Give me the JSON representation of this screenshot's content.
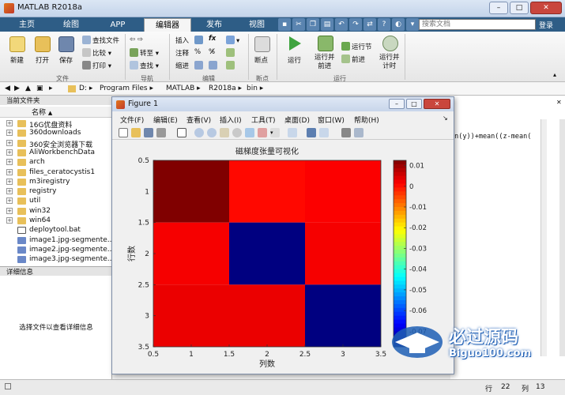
{
  "window": {
    "title": "MATLAB R2018a"
  },
  "tabs": [
    "主页",
    "绘图",
    "APP",
    "编辑器",
    "发布",
    "视图"
  ],
  "active_tab": "编辑器",
  "search": {
    "placeholder": "搜索文档"
  },
  "login": "登录",
  "ribbon": {
    "file": {
      "new": "新建",
      "open": "打开",
      "save": "保存",
      "find_files": "查找文件",
      "compare": "比较",
      "print": "打印",
      "group": "文件"
    },
    "nav": {
      "goto": "转至",
      "find": "查找",
      "group": "导航"
    },
    "edit": {
      "insert": "插入",
      "comment": "注释",
      "indent": "缩进",
      "fx": "fx",
      "group": "编辑"
    },
    "breakpoints": {
      "label": "断点",
      "group": "断点"
    },
    "run": {
      "run": "运行",
      "run_advance": "运行并\n前进",
      "run_section": "运行节",
      "advance": "前进",
      "run_time": "运行并\n计时",
      "group": "运行"
    }
  },
  "address": [
    "D:",
    "Program Files",
    "MATLAB",
    "R2018a",
    "bin"
  ],
  "left_panel": {
    "title": "当前文件夹",
    "col_name": "名称",
    "sort_arrow": "▲",
    "files": [
      {
        "name": "16G优盘资料",
        "type": "folder"
      },
      {
        "name": "360downloads",
        "type": "folder"
      },
      {
        "name": "360安全浏览器下载",
        "type": "folder"
      },
      {
        "name": "AliWorkbenchData",
        "type": "folder"
      },
      {
        "name": "arch",
        "type": "folder"
      },
      {
        "name": "files_ceratocystis1",
        "type": "folder"
      },
      {
        "name": "m3iregistry",
        "type": "folder"
      },
      {
        "name": "registry",
        "type": "folder"
      },
      {
        "name": "util",
        "type": "folder"
      },
      {
        "name": "win32",
        "type": "folder"
      },
      {
        "name": "win64",
        "type": "folder"
      },
      {
        "name": "deploytool.bat",
        "type": "file"
      },
      {
        "name": "image1.jpg-segmente...",
        "type": "image"
      },
      {
        "name": "image2.jpg-segmente...",
        "type": "image"
      },
      {
        "name": "image3.jpg-segmente...",
        "type": "image"
      }
    ],
    "detail_title": "详细信息",
    "detail_text": "选择文件以查看详细信息"
  },
  "editor_snippet": "an(y))+mean((z-mean(",
  "status": {
    "row_label": "行",
    "row": "22",
    "col_label": "列",
    "col": "13"
  },
  "figure": {
    "title": "Figure 1",
    "menu": [
      "文件(F)",
      "编辑(E)",
      "查看(V)",
      "插入(I)",
      "工具(T)",
      "桌面(D)",
      "窗口(W)",
      "帮助(H)"
    ]
  },
  "chart_data": {
    "type": "heatmap",
    "title": "磁梯度张量可视化",
    "xlabel": "列数",
    "ylabel": "行数",
    "x_ticks": [
      "0.5",
      "1",
      "1.5",
      "2",
      "2.5",
      "3",
      "3.5"
    ],
    "y_ticks": [
      "0.5",
      "1",
      "1.5",
      "2",
      "2.5",
      "3",
      "3.5"
    ],
    "xlim": [
      0.5,
      3.5
    ],
    "ylim": [
      0.5,
      3.5
    ],
    "y_reversed": true,
    "matrix": [
      [
        0.0125,
        0.0005,
        0.0015
      ],
      [
        0.002,
        -0.0775,
        0.002
      ],
      [
        0.003,
        0.003,
        -0.0775
      ]
    ],
    "colorbar": {
      "ticks": [
        "0.01",
        "0",
        "-0.01",
        "-0.02",
        "-0.03",
        "-0.04",
        "-0.05",
        "-0.06",
        "-0.07"
      ],
      "tick_values": [
        0.01,
        0,
        -0.01,
        -0.02,
        -0.03,
        -0.04,
        -0.05,
        -0.06,
        -0.07
      ],
      "range": [
        -0.0775,
        0.0125
      ],
      "colormap": "jet"
    }
  },
  "watermark": {
    "brand": "必过源码",
    "url": "Biguo100.com"
  }
}
